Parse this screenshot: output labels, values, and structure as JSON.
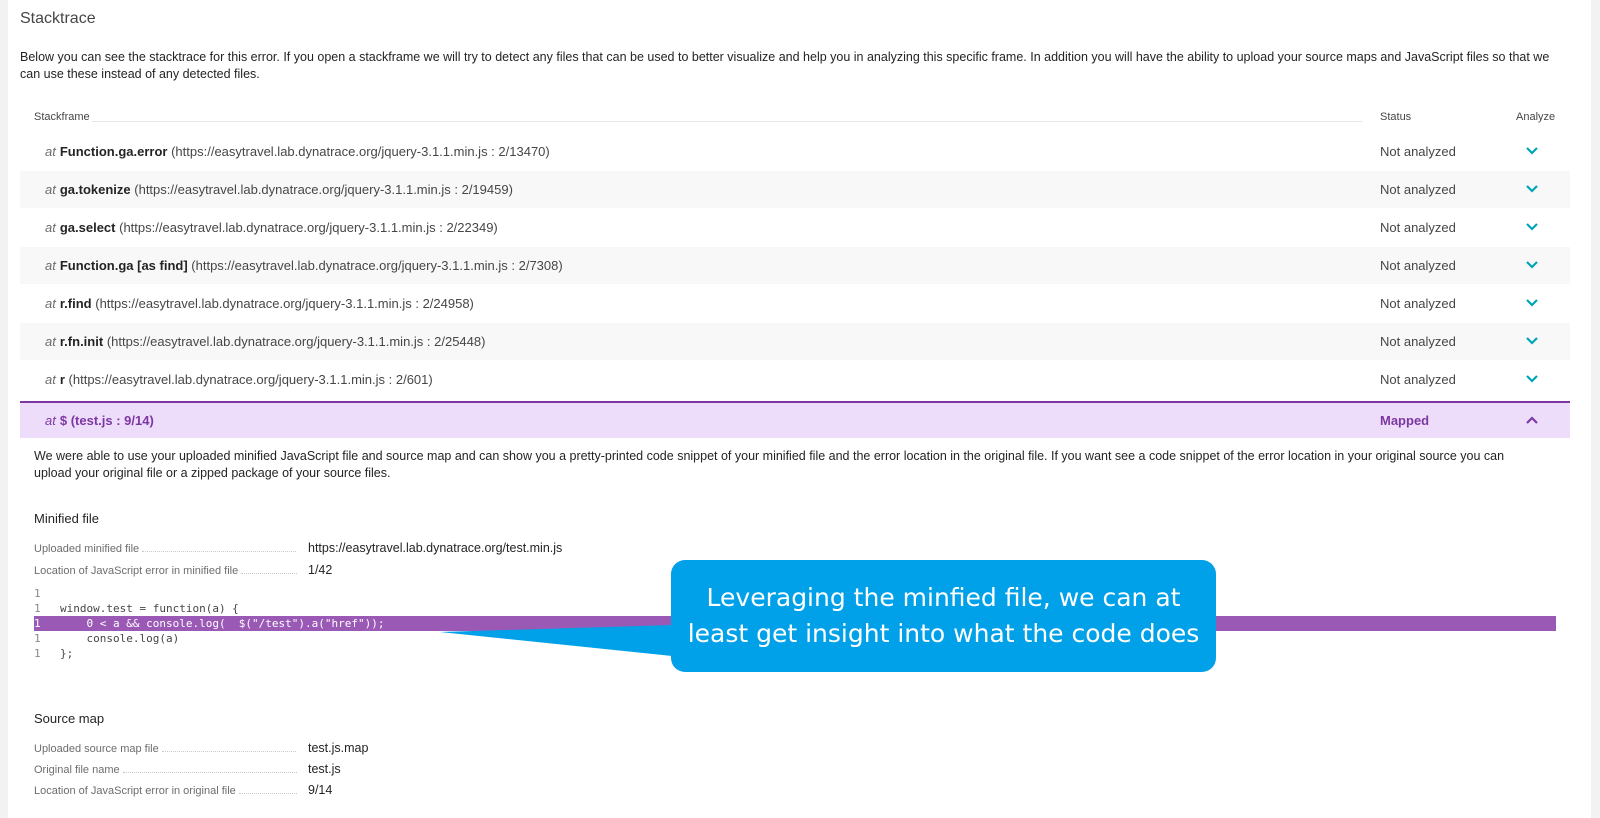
{
  "page": {
    "title": "Stacktrace",
    "intro": "Below you can see the stacktrace for this error. If you open a stackframe we will try to detect any files that can be used to better visualize and help you in analyzing this specific frame. In addition you will have the ability to upload your source maps and JavaScript files so that we can use these instead of any detected files."
  },
  "table": {
    "headers": {
      "stackframe": "Stackframe",
      "status": "Status",
      "analyze": "Analyze"
    },
    "at_label": "at",
    "rows": [
      {
        "fn": "Function.ga.error",
        "loc": "(https://easytravel.lab.dynatrace.org/jquery-3.1.1.min.js : 2/13470)",
        "status": "Not analyzed"
      },
      {
        "fn": "ga.tokenize",
        "loc": "(https://easytravel.lab.dynatrace.org/jquery-3.1.1.min.js : 2/19459)",
        "status": "Not analyzed"
      },
      {
        "fn": "ga.select",
        "loc": "(https://easytravel.lab.dynatrace.org/jquery-3.1.1.min.js : 2/22349)",
        "status": "Not analyzed"
      },
      {
        "fn": "Function.ga [as find]",
        "loc": "(https://easytravel.lab.dynatrace.org/jquery-3.1.1.min.js : 2/7308)",
        "status": "Not analyzed"
      },
      {
        "fn": "r.find",
        "loc": "(https://easytravel.lab.dynatrace.org/jquery-3.1.1.min.js : 2/24958)",
        "status": "Not analyzed"
      },
      {
        "fn": "r.fn.init",
        "loc": "(https://easytravel.lab.dynatrace.org/jquery-3.1.1.min.js : 2/25448)",
        "status": "Not analyzed"
      },
      {
        "fn": "r",
        "loc": "(https://easytravel.lab.dynatrace.org/jquery-3.1.1.min.js : 2/601)",
        "status": "Not analyzed"
      },
      {
        "fn": "$",
        "loc": "(test.js : 9/14)",
        "status": "Mapped"
      }
    ]
  },
  "detail": {
    "description": "We were able to use your uploaded minified JavaScript file and source map and can show you a pretty-printed code snippet of your minified file and the error location in the original file. If you want see a code snippet of the error location in your original source you can upload your original file or a zipped package of your source files.",
    "minified": {
      "title": "Minified file",
      "uploaded_label": "Uploaded minified file",
      "uploaded_value": "https://easytravel.lab.dynatrace.org/test.min.js",
      "location_label": "Location of JavaScript error in minified file",
      "location_value": "1/42"
    },
    "code": [
      {
        "ln": "1",
        "src": ""
      },
      {
        "ln": "1",
        "src": "window.test = function(a) {"
      },
      {
        "ln": "1",
        "src": "    0 < a && console.log(  $(\"/test\").a(\"href\"));"
      },
      {
        "ln": "1",
        "src": "    console.log(a)"
      },
      {
        "ln": "1",
        "src": "};"
      }
    ],
    "source_map": {
      "title": "Source map",
      "uploaded_label": "Uploaded source map file",
      "uploaded_value": "test.js.map",
      "original_label": "Original file name",
      "original_value": "test.js",
      "location_label": "Location of JavaScript error in original file",
      "location_value": "9/14"
    }
  },
  "callout": {
    "line1": "Leveraging the minfied file, we can at",
    "line2": "least get insight into what the code does"
  },
  "colors": {
    "accent_teal": "#00a4b4",
    "mapped_purple": "#7c38a1",
    "mapped_bg": "#eedcfb",
    "code_highlight": "#9b59b6",
    "callout_blue": "#00a1e9"
  },
  "icons": {
    "expand": "chevron-down-icon",
    "collapse": "chevron-up-icon"
  }
}
